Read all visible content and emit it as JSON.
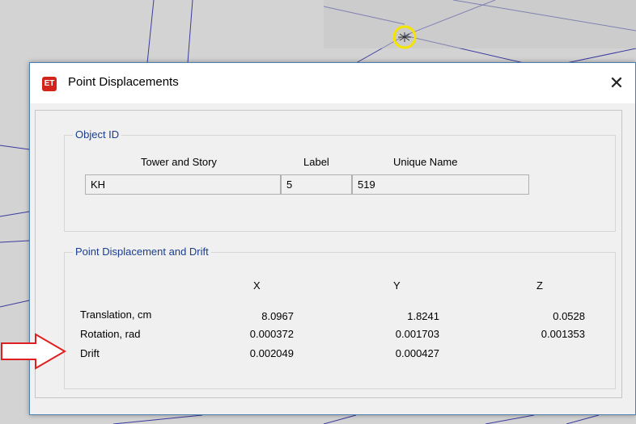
{
  "dialog": {
    "icon_text": "ET",
    "title": "Point Displacements",
    "close_label": "✕"
  },
  "object_id": {
    "label": "Object ID",
    "headers": {
      "tower_story": "Tower and Story",
      "label": "Label",
      "unique_name": "Unique Name"
    },
    "values": {
      "tower_story": "KH",
      "label": "5",
      "unique_name": "519"
    }
  },
  "displacement": {
    "label": "Point Displacement and Drift",
    "columns": [
      "X",
      "Y",
      "Z"
    ],
    "rows": [
      {
        "label": "Translation, cm",
        "x": "8.0967",
        "y": "1.8241",
        "z": "0.0528"
      },
      {
        "label": "Rotation, rad",
        "x": "0.000372",
        "y": "0.001703",
        "z": "0.001353"
      },
      {
        "label": "Drift",
        "x": "0.002049",
        "y": "0.000427",
        "z": ""
      }
    ]
  },
  "colors": {
    "annotation_arrow": "#e02020",
    "marker": "#f5e400",
    "grid_lines": "#3a3aa0"
  }
}
